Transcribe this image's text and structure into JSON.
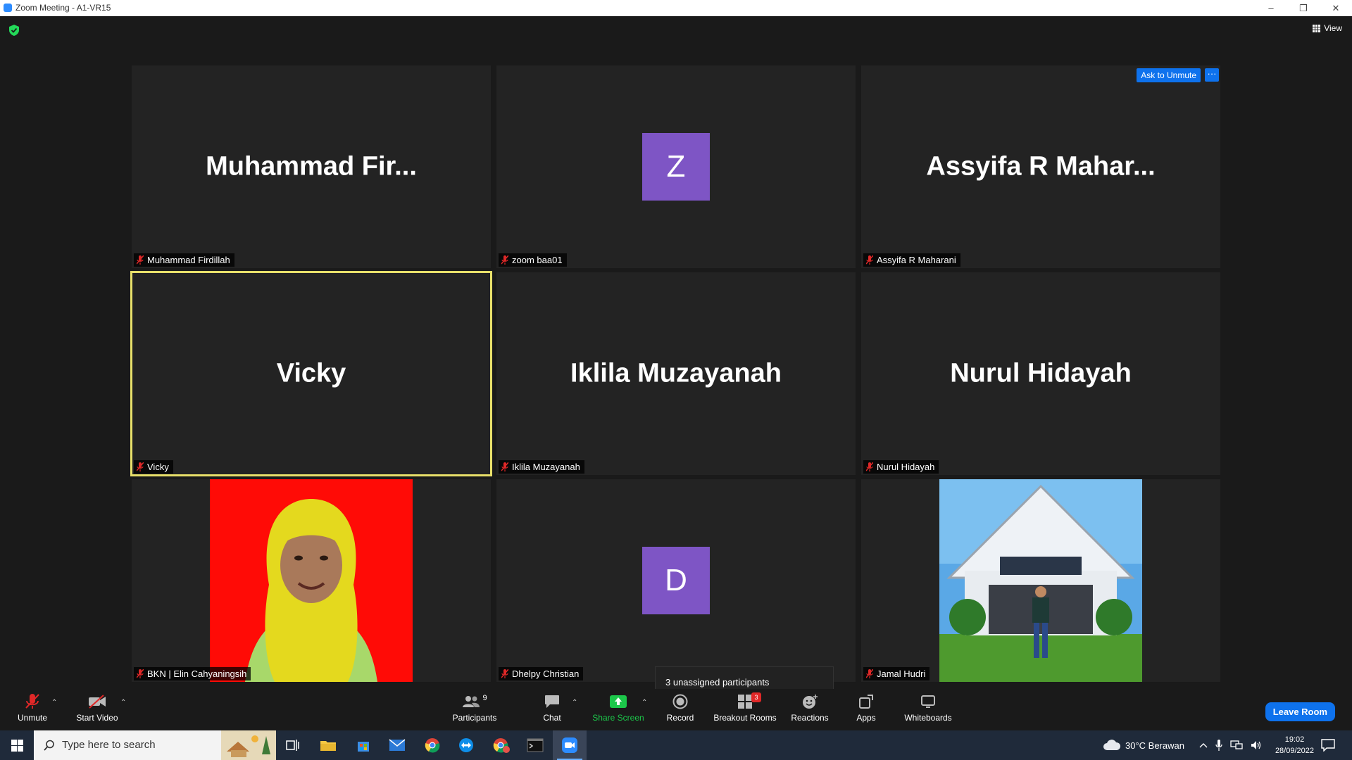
{
  "window": {
    "title": "Zoom Meeting - A1-VR15",
    "minimize": "–",
    "restore": "❐",
    "close": "✕"
  },
  "view_label": "View",
  "tiles": [
    {
      "display": "Muhammad  Fir...",
      "name": "Muhammad Firdillah"
    },
    {
      "avatar": "Z",
      "name": "zoom baa01"
    },
    {
      "display": "Assyifa  R  Mahar...",
      "name": "Assyifa R Maharani"
    },
    {
      "display": "Vicky",
      "name": "Vicky"
    },
    {
      "display": "Iklila Muzayanah",
      "name": "Iklila Muzayanah"
    },
    {
      "display": "Nurul Hidayah",
      "name": "Nurul Hidayah"
    },
    {
      "name": "BKN | Elin Cahyaningsih"
    },
    {
      "avatar": "D",
      "name": "Dhelpy Christian"
    },
    {
      "name": "Jamal Hudri"
    }
  ],
  "tile_actions": {
    "ask_to_unmute": "Ask to Unmute",
    "more": "···"
  },
  "unassigned_tooltip": "3 unassigned participants",
  "toolbar": {
    "unmute": "Unmute",
    "start_video": "Start Video",
    "participants": "Participants",
    "participants_count": "9",
    "chat": "Chat",
    "share_screen": "Share Screen",
    "record": "Record",
    "breakout_rooms": "Breakout Rooms",
    "breakout_count": "3",
    "reactions": "Reactions",
    "apps": "Apps",
    "whiteboards": "Whiteboards",
    "leave_room": "Leave Room",
    "caret": "⌃"
  },
  "taskbar": {
    "search_placeholder": "Type here to search",
    "weather": "30°C  Berawan",
    "time": "19:02",
    "date": "28/09/2022"
  },
  "colors": {
    "accent": "#0e72ed",
    "share_green": "#1cc74a",
    "avatar_purple": "#7e55c5",
    "active_speaker": "#e8e06a",
    "mute_red": "#e02828"
  }
}
